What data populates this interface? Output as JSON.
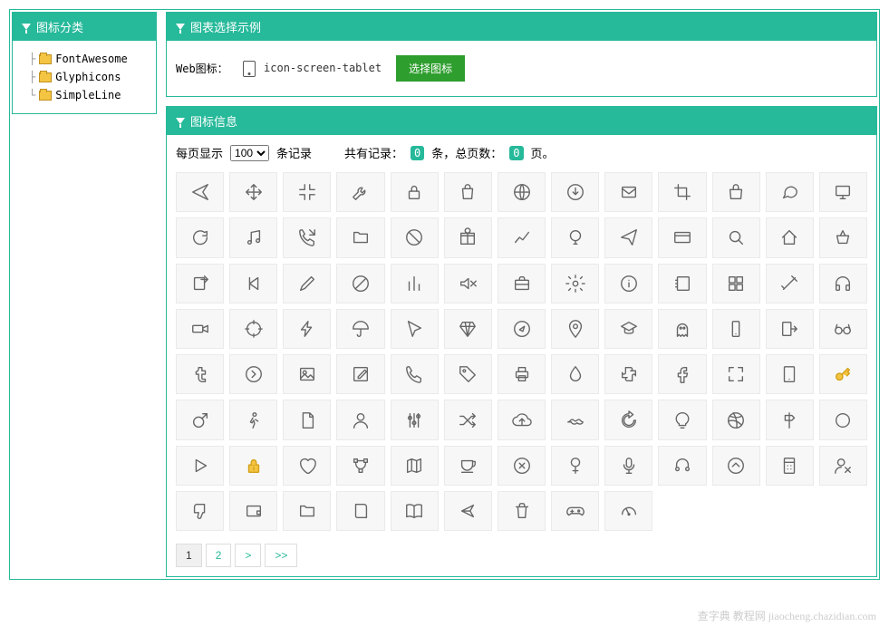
{
  "sidebar": {
    "title": "图标分类",
    "items": [
      {
        "label": "FontAwesome"
      },
      {
        "label": "Glyphicons"
      },
      {
        "label": "SimpleLine"
      }
    ]
  },
  "example_panel": {
    "title": "图表选择示例",
    "label": "Web图标：",
    "icon_label": "icon-screen-tablet",
    "button": "选择图标"
  },
  "info_panel": {
    "title": "图标信息",
    "per_page_label_before": "每页显示",
    "per_page_value": "100",
    "per_page_label_after": "条记录",
    "stats_before": "共有记录：",
    "record_count": "0",
    "stats_mid1": "条，总页数：",
    "page_count": "0",
    "stats_mid2": "页。"
  },
  "icons": [
    "plane",
    "move",
    "shrink",
    "wrench",
    "lock",
    "bag",
    "globe",
    "download-circle",
    "envelope",
    "crop",
    "handbag",
    "speech",
    "monitor",
    "reload",
    "music",
    "call-out",
    "folder",
    "ban",
    "gift",
    "line-chart",
    "globe-light",
    "paper-plane",
    "credit-card",
    "magnifier",
    "home",
    "basket",
    "share",
    "prev",
    "pencil",
    "ban-alt",
    "bar-chart",
    "volume-off",
    "briefcase",
    "settings",
    "info",
    "notebook",
    "grid",
    "magic-wand",
    "headphones",
    "camcorder",
    "target",
    "energy",
    "umbrella",
    "cursor",
    "diamond",
    "compass",
    "location",
    "graduation",
    "ghost",
    "smartphone",
    "logout",
    "glasses",
    "tumblr",
    "arrow-right-circle",
    "picture",
    "edit",
    "phone",
    "tag",
    "printer",
    "drop",
    "puzzle",
    "facebook",
    "fullscreen",
    "tablet",
    "key",
    "male",
    "walk",
    "document",
    "user",
    "equalizer",
    "shuffle",
    "cloud-upload",
    "mustache",
    "refresh",
    "bulb",
    "dribbble",
    "signpost",
    "circle",
    "play",
    "lock-gold",
    "heart",
    "vector",
    "map",
    "cup",
    "close-circle",
    "female",
    "microphone",
    "earphones",
    "arrow-up-circle",
    "calculator",
    "user-unfollow",
    "dislike",
    "wallet",
    "folder-alt",
    "book",
    "book-open",
    "share-alt",
    "trash",
    "game",
    "speedometer"
  ],
  "pagination": {
    "pages": [
      "1",
      "2"
    ],
    "next": ">",
    "last": ">>"
  },
  "watermark": "查字典 教程网\njiaocheng.chazidian.com"
}
